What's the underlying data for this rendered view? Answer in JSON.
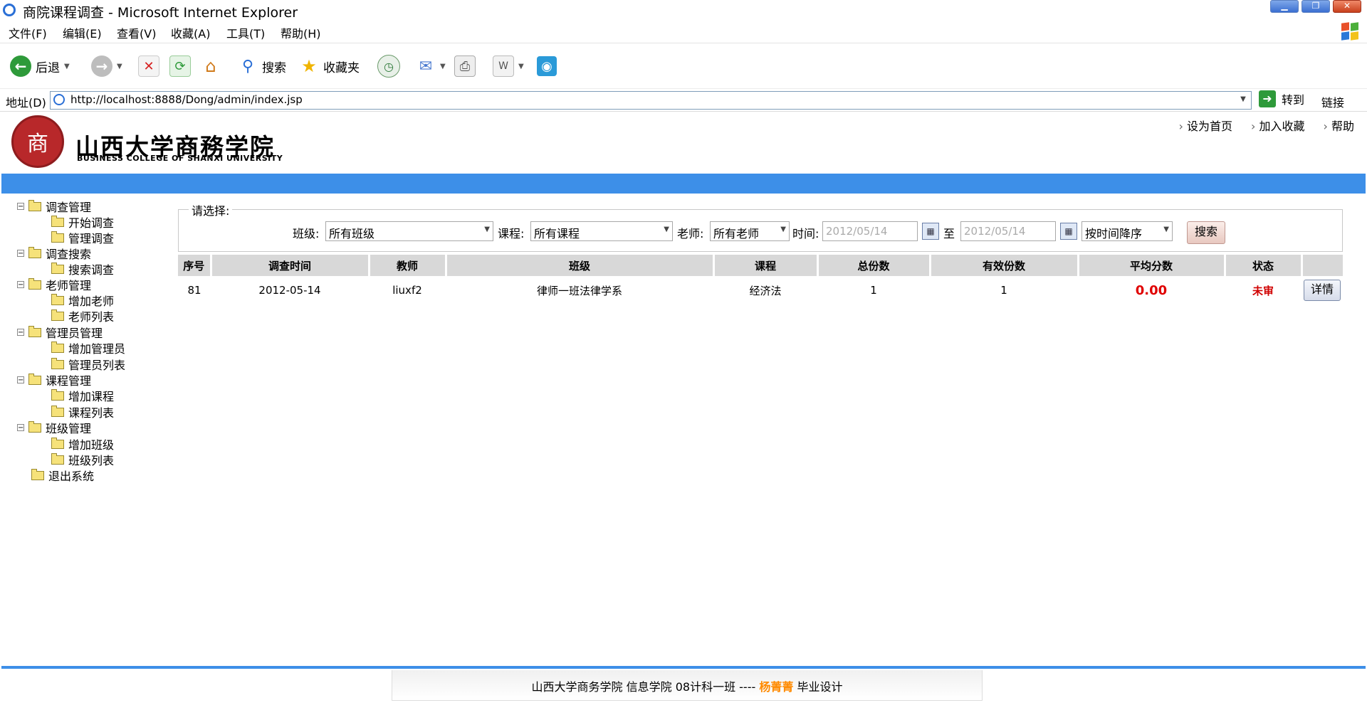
{
  "window": {
    "title": "商院课程调查 - Microsoft Internet Explorer"
  },
  "menu": [
    "文件(F)",
    "编辑(E)",
    "查看(V)",
    "收藏(A)",
    "工具(T)",
    "帮助(H)"
  ],
  "toolbar": {
    "back_label": "后退",
    "search_label": "搜索",
    "favorites_label": "收藏夹"
  },
  "address": {
    "label": "地址(D)",
    "url": "http://localhost:8888/Dong/admin/index.jsp",
    "go_label": "转到",
    "links_label": "链接"
  },
  "header": {
    "school_cn": "山西大学商務学院",
    "school_en": "BUSINESS COLLEGE OF SHANXI UNIVERSITY",
    "links": [
      "设为首页",
      "加入收藏",
      "帮助"
    ]
  },
  "sidebar": {
    "groups": [
      {
        "label": "调查管理",
        "items": [
          "开始调查",
          "管理调查"
        ]
      },
      {
        "label": "调查搜索",
        "items": [
          "搜索调查"
        ]
      },
      {
        "label": "老师管理",
        "items": [
          "增加老师",
          "老师列表"
        ]
      },
      {
        "label": "管理员管理",
        "items": [
          "增加管理员",
          "管理员列表"
        ]
      },
      {
        "label": "课程管理",
        "items": [
          "增加课程",
          "课程列表"
        ]
      },
      {
        "label": "班级管理",
        "items": [
          "增加班级",
          "班级列表"
        ]
      }
    ],
    "logout": "退出系统"
  },
  "filter": {
    "legend": "请选择:",
    "class_label": "班级:",
    "class_value": "所有班级",
    "course_label": "课程:",
    "course_value": "所有课程",
    "teacher_label": "老师:",
    "teacher_value": "所有老师",
    "time_label": "时间:",
    "date_from": "2012/05/14",
    "to_label": "至",
    "date_to": "2012/05/14",
    "sort_value": "按时间降序",
    "search_label": "搜索"
  },
  "table": {
    "headers": [
      "序号",
      "调查时间",
      "教师",
      "班级",
      "课程",
      "总份数",
      "有效份数",
      "平均分数",
      "状态",
      ""
    ],
    "rows": [
      {
        "id": "81",
        "time": "2012-05-14",
        "teacher": "liuxf2",
        "class": "律师一班法律学系",
        "course": "经济法",
        "total": "1",
        "valid": "1",
        "avg": "0.00",
        "status": "未审",
        "action": "详情"
      }
    ]
  },
  "footer": {
    "prefix": "山西大学商务学院  信息学院  08计科一班  ----",
    "author": "杨菁菁",
    "suffix": "毕业设计"
  },
  "colors": {
    "band": "#3d8fe8",
    "seal": "#b8282a",
    "alert_red": "#e00000",
    "author_orange": "#ff8a00"
  }
}
